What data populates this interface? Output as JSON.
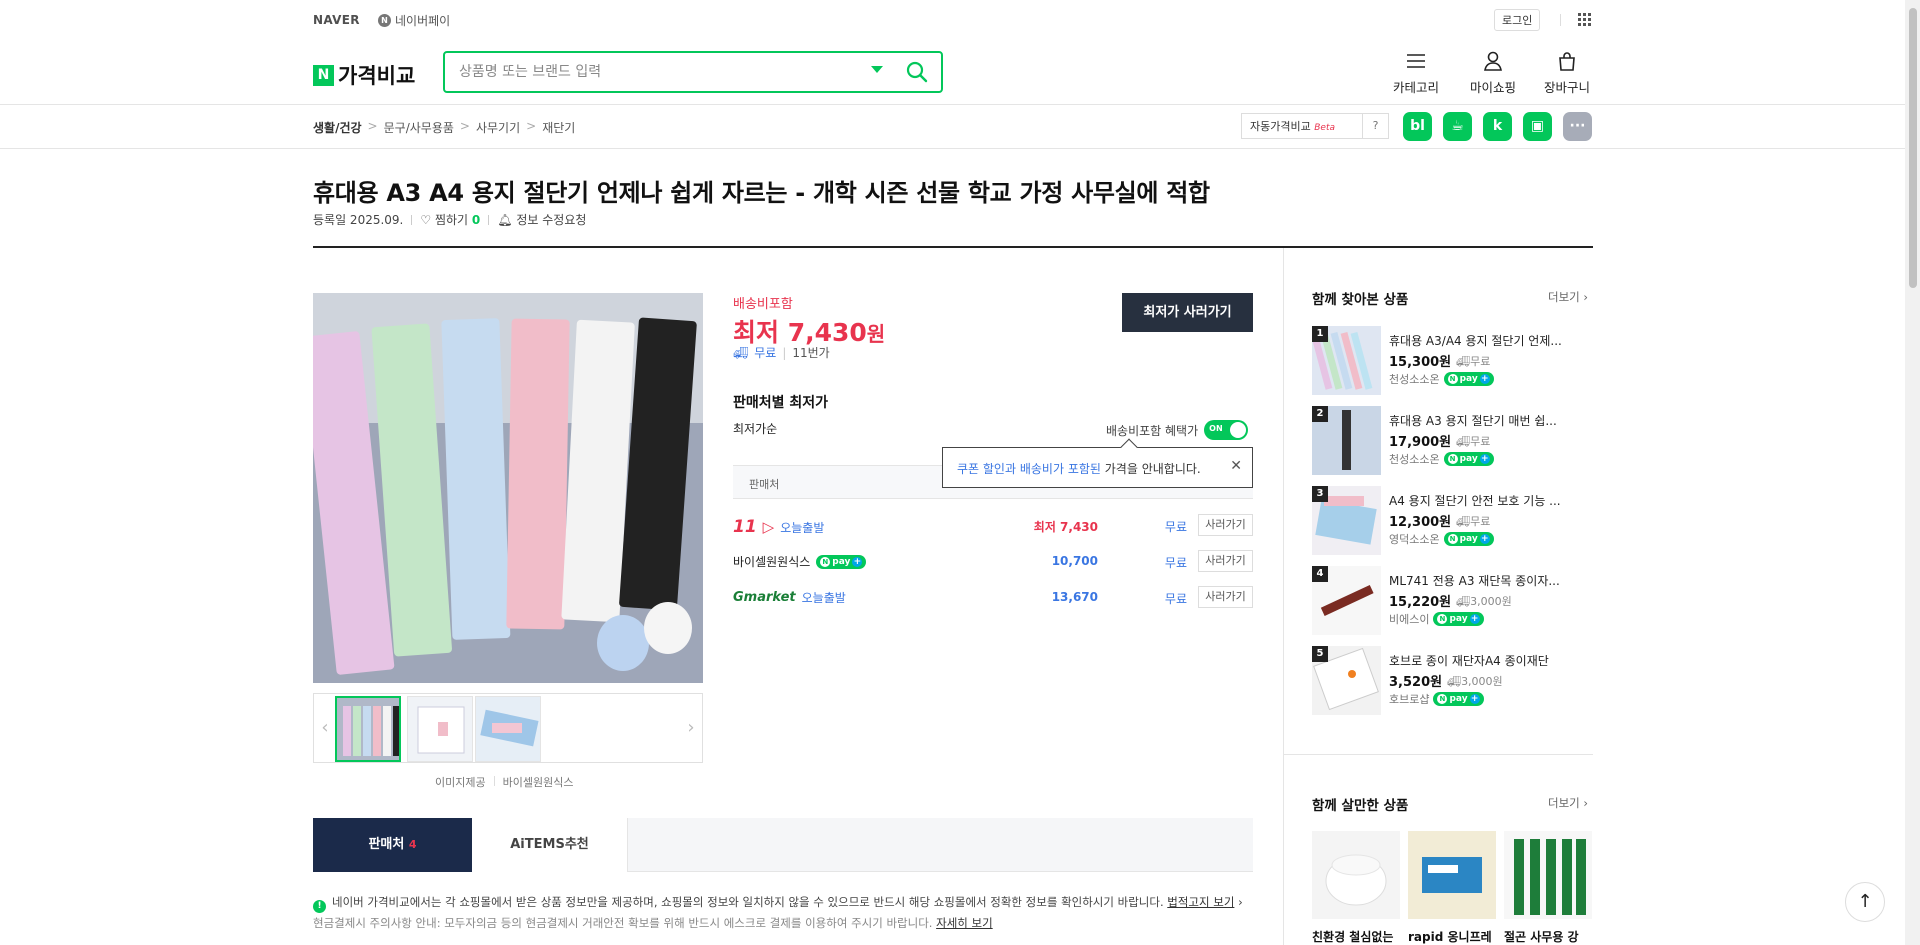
{
  "topbar": {
    "naver": "NAVER",
    "npay": "네이버페이",
    "login": "로그인"
  },
  "header": {
    "logo": "가격비교",
    "search_placeholder": "상품명 또는 브랜드 입력",
    "icons": [
      {
        "label": "카테고리"
      },
      {
        "label": "마이쇼핑"
      },
      {
        "label": "장바구니"
      }
    ]
  },
  "breadcrumb": [
    "생활/건강",
    "문구/사무용품",
    "사무기기",
    "재단기"
  ],
  "auto_compare": {
    "label": "자동가격비교",
    "beta": "Beta",
    "help": "?"
  },
  "share": [
    "bl",
    "카페",
    "k",
    "밴드",
    "···"
  ],
  "product": {
    "title": "휴대용 A3 A4 용지 절단기 언제나 쉽게 자르는 - 개학 시즌 선물 학교 가정 사무실에 적합",
    "registered": "등록일 2025.09.",
    "wish_label": "찜하기",
    "wish_count": "0",
    "report": "정보 수정요청"
  },
  "price": {
    "shipping_included": "배송비포함",
    "lowest": "최저 7,430",
    "won": "원",
    "ship_free": "무료",
    "ship_mall": "11번가",
    "buy_button": "최저가 사러가기"
  },
  "image_credit": {
    "label": "이미지제공",
    "seller": "바이셀원원식스"
  },
  "sellers": {
    "heading": "판매처별 최저가",
    "sort": "최저가순",
    "benefit": "배송비포함 혜택가",
    "toggle": "ON",
    "col_seller": "판매처",
    "tooltip_a": "쿠폰 할인",
    "tooltip_b": "과 ",
    "tooltip_c": "배송비가 포함된",
    "tooltip_d": " 가격을 안내합니다.",
    "rows": [
      {
        "mall": "11번가",
        "logo": "11",
        "delivery": "오늘출발",
        "price": "최저 7,430",
        "ship": "무료",
        "btn": "사러가기"
      },
      {
        "mall": "바이셀원원식스",
        "logo": "",
        "delivery": "",
        "price": "10,700",
        "ship": "무료",
        "btn": "사러가기"
      },
      {
        "mall": "Gmarket",
        "logo": "Gmarket",
        "delivery": "오늘출발",
        "price": "13,670",
        "ship": "무료",
        "btn": "사러가기"
      }
    ]
  },
  "tabs": {
    "sellers": "판매처",
    "sellers_count": "4",
    "aitems": "AiTEMS추천"
  },
  "notice": {
    "text": "네이버 가격비교에서는 각 쇼핑몰에서 받은 상품 정보만을 제공하며, 쇼핑몰의 정보와 일치하지 않을 수 있으므로 반드시 해당 쇼핑몰에서 정확한 정보를 확인하시기 바랍니다.",
    "link": "법적고지 보기",
    "text2": "현금결제시 주의사항 안내: 모두자의금 등의 현금결제시 거래안전 확보를 위해 반드시 에스크로 결제를 이용하여 주시기 바랍니다.",
    "link2": "자세히 보기"
  },
  "sidebar": {
    "viewed_heading": "함께 찾아본 상품",
    "more": "더보기",
    "viewed": [
      {
        "rank": "1",
        "name": "휴대용 A3/A4 용지 절단기 언제...",
        "price": "15,300원",
        "ship": "무료",
        "store": "천성소소온"
      },
      {
        "rank": "2",
        "name": "휴대용 A3 용지 절단기 매번 쉽...",
        "price": "17,900원",
        "ship": "무료",
        "store": "천성소소온"
      },
      {
        "rank": "3",
        "name": "A4 용지 절단기 안전 보호 기능 ...",
        "price": "12,300원",
        "ship": "무료",
        "store": "영덕소소온"
      },
      {
        "rank": "4",
        "name": "ML741 전용 A3 재단목 종이자...",
        "price": "15,220원",
        "ship": "3,000원",
        "store": "비에스이"
      },
      {
        "rank": "5",
        "name": "호브로 종이 재단자A4 종이재단",
        "price": "3,520원",
        "ship": "3,000원",
        "store": "호브로샵"
      }
    ],
    "bought_heading": "함께 살만한 상품",
    "bought": [
      {
        "name": "친환경 철심없는"
      },
      {
        "name": "rapid 옹니프레"
      },
      {
        "name": "절곤 사무용 강"
      }
    ]
  },
  "colors": {
    "brand": "#03c75a",
    "price_red": "#e8344e",
    "link_blue": "#3a76e2",
    "dark_navy": "#1b2a4a"
  }
}
